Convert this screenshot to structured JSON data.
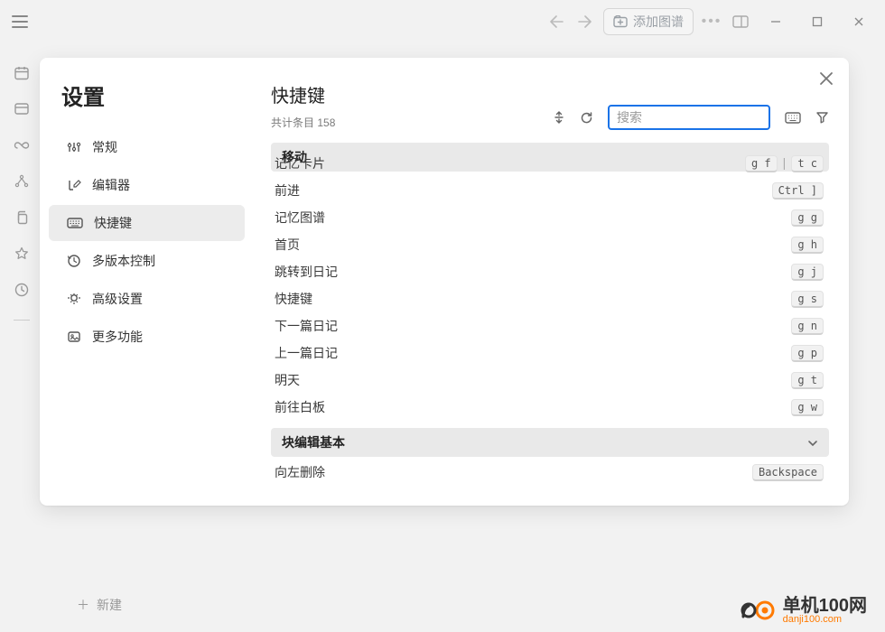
{
  "titlebar": {
    "add_graph_label": "添加图谱"
  },
  "left_rail": {
    "new_label": "新建"
  },
  "modal": {
    "title": "设置",
    "nav": [
      {
        "label": "常规"
      },
      {
        "label": "编辑器"
      },
      {
        "label": "快捷键"
      },
      {
        "label": "多版本控制"
      },
      {
        "label": "高级设置"
      },
      {
        "label": "更多功能"
      }
    ],
    "panel": {
      "title": "快捷键",
      "sub_prefix": "共计条目",
      "count": "158",
      "search_placeholder": "搜索"
    },
    "sections": [
      {
        "title": "移动",
        "items": [
          {
            "label": "记忆卡片",
            "keys": [
              "g f",
              "t c"
            ]
          },
          {
            "label": "前进",
            "keys": [
              "Ctrl ]"
            ]
          },
          {
            "label": "记忆图谱",
            "keys": [
              "g g"
            ]
          },
          {
            "label": "首页",
            "keys": [
              "g h"
            ]
          },
          {
            "label": "跳转到日记",
            "keys": [
              "g j"
            ]
          },
          {
            "label": "快捷键",
            "keys": [
              "g s"
            ]
          },
          {
            "label": "下一篇日记",
            "keys": [
              "g n"
            ]
          },
          {
            "label": "上一篇日记",
            "keys": [
              "g p"
            ]
          },
          {
            "label": "明天",
            "keys": [
              "g t"
            ]
          },
          {
            "label": "前往白板",
            "keys": [
              "g w"
            ]
          }
        ]
      },
      {
        "title": "块编辑基本",
        "items": [
          {
            "label": "向左删除",
            "keys": [
              "Backspace"
            ]
          }
        ]
      }
    ]
  },
  "watermark": {
    "text": "单机100网",
    "url": "danji100.com"
  }
}
